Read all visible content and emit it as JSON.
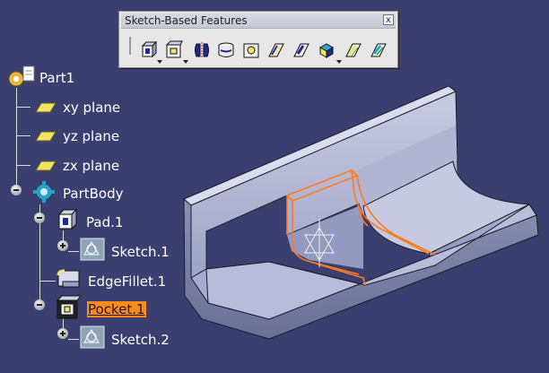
{
  "toolbar": {
    "title": "Sketch-Based Features",
    "close_glyph": "x",
    "buttons": [
      {
        "name": "pad-icon",
        "has_dropdown": true
      },
      {
        "name": "pocket-icon",
        "has_dropdown": true
      },
      {
        "name": "shaft-icon",
        "has_dropdown": false
      },
      {
        "name": "groove-icon",
        "has_dropdown": false
      },
      {
        "name": "hole-icon",
        "has_dropdown": false
      },
      {
        "name": "rib-icon",
        "has_dropdown": false
      },
      {
        "name": "slot-icon",
        "has_dropdown": false
      },
      {
        "name": "multi-section-solid-icon",
        "has_dropdown": true
      },
      {
        "name": "stiffener-icon",
        "has_dropdown": false
      },
      {
        "name": "removed-multi-section-icon",
        "has_dropdown": false
      }
    ]
  },
  "tree": {
    "root": "Part1",
    "planes": [
      "xy plane",
      "yz plane",
      "zx plane"
    ],
    "body": "PartBody",
    "features": {
      "pad": "Pad.1",
      "pad_sketch": "Sketch.1",
      "fillet": "EdgeFillet.1",
      "pocket": "Pocket.1",
      "pocket_sketch": "Sketch.2"
    },
    "selected": "Pocket.1"
  },
  "colors": {
    "background": "#3b3f6f",
    "selection": "#ff8c1a",
    "part_face": "#b8bcd8",
    "highlight_edge": "#ff7a1a"
  }
}
